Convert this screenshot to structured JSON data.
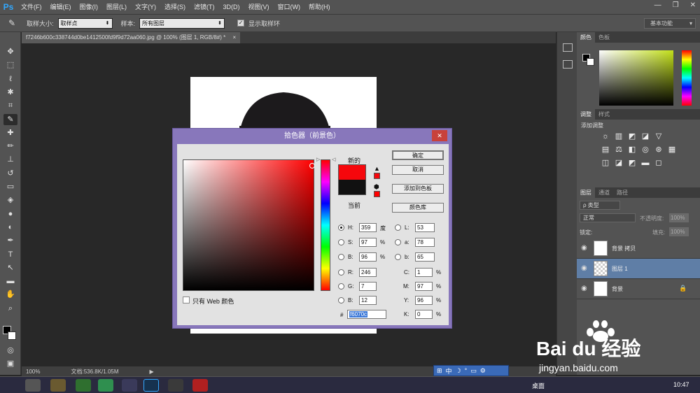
{
  "app": {
    "logo": "Ps"
  },
  "menu": [
    "文件(F)",
    "编辑(E)",
    "图像(I)",
    "图层(L)",
    "文字(Y)",
    "选择(S)",
    "滤镜(T)",
    "3D(D)",
    "视图(V)",
    "窗口(W)",
    "帮助(H)"
  ],
  "window_controls": {
    "minimize": "—",
    "restore": "❐",
    "close": "✕"
  },
  "options": {
    "sample_size_label": "取样大小:",
    "sample_size_value": "取样点",
    "sample_label": "样本:",
    "sample_value": "所有图层",
    "show_ring_label": "显示取样环",
    "show_ring_checked": true,
    "workspace": "基本功能"
  },
  "document": {
    "tab_title": "f7246b600c338744d0be1412500fd9f9d72aa060.jpg @ 100% (图层 1, RGB/8#) *",
    "tab_close": "×",
    "zoom": "100%",
    "doc_size": "文档:536.8K/1.05M"
  },
  "color_panel": {
    "tabs": [
      "颜色",
      "色板"
    ],
    "active": 0
  },
  "adjust_panel": {
    "tabs": [
      "调整",
      "样式"
    ],
    "active": 0,
    "subtitle": "添加调整"
  },
  "layers_panel": {
    "tabs": [
      "图层",
      "通道",
      "路径"
    ],
    "active": 0,
    "filter": "类型",
    "blend_mode": "正常",
    "opacity_label": "不透明度:",
    "opacity": "100%",
    "lock_label": "锁定:",
    "fill_label": "填充:",
    "fill": "100%",
    "layers": [
      {
        "name": "背景 拷贝",
        "selected": false,
        "locked": false
      },
      {
        "name": "图层 1",
        "selected": true,
        "locked": false
      },
      {
        "name": "背景",
        "selected": false,
        "locked": true
      }
    ]
  },
  "dialog": {
    "title": "拾色器（前景色）",
    "close": "✕",
    "new_label": "新的",
    "current_label": "当前",
    "new_color": "#f6070c",
    "current_color": "#111111",
    "buttons": {
      "ok": "确定",
      "cancel": "取消",
      "add_swatch": "添加到色板",
      "libraries": "颜色库"
    },
    "web_only_label": "只有 Web 颜色",
    "fields": {
      "H": {
        "label": "H:",
        "value": "359",
        "unit": "度"
      },
      "S": {
        "label": "S:",
        "value": "97",
        "unit": "%"
      },
      "B": {
        "label": "B:",
        "value": "96",
        "unit": "%"
      },
      "R": {
        "label": "R:",
        "value": "246"
      },
      "G": {
        "label": "G:",
        "value": "7"
      },
      "Bl": {
        "label": "B:",
        "value": "12"
      },
      "L": {
        "label": "L:",
        "value": "53"
      },
      "a": {
        "label": "a:",
        "value": "78"
      },
      "b": {
        "label": "b:",
        "value": "65"
      },
      "C": {
        "label": "C:",
        "value": "1",
        "unit": "%"
      },
      "M": {
        "label": "M:",
        "value": "97",
        "unit": "%"
      },
      "Y": {
        "label": "Y:",
        "value": "96",
        "unit": "%"
      },
      "K": {
        "label": "K:",
        "value": "0",
        "unit": "%"
      }
    },
    "hex_label": "#",
    "hex_value": "f6070c"
  },
  "ime_bar": {
    "items": [
      "中"
    ]
  },
  "watermark": {
    "brand": "Bai du 经验",
    "url": "jingyan.baidu.com"
  },
  "taskbar": {
    "desktop_label": "桌面",
    "time": "10:47"
  },
  "colors": {
    "accent": "#31a8ff",
    "dialog_frame": "#8877bb",
    "close_red": "#c8413b",
    "selected_layer": "#5f7ea6"
  }
}
